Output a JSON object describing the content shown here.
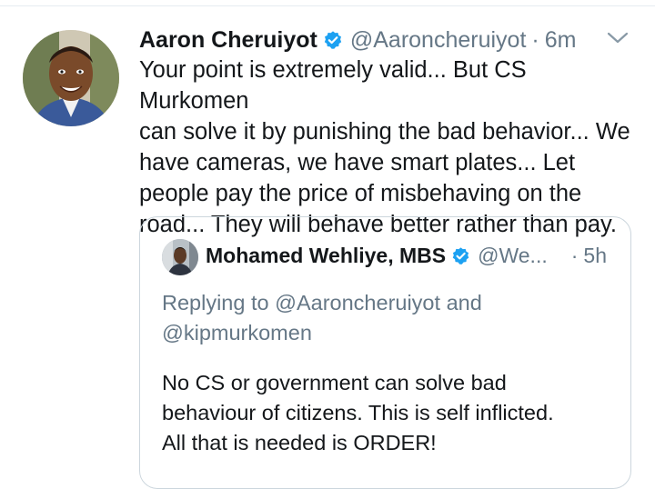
{
  "tweet": {
    "author": {
      "display_name": "Aaron Cheruiyot",
      "handle": "@Aaroncheruiyot",
      "verified_icon": "verified-badge-icon",
      "avatar": "avatar"
    },
    "separator": "·",
    "time": "6m",
    "menu_icon": "chevron-down-icon",
    "text": "Your point is extremely valid... But CS Murkomen\ncan solve it by punishing the bad behavior... We\nhave cameras, we have smart plates... Let\npeople pay the price of misbehaving on the\nroad... They will behave better rather than pay."
  },
  "quoted_tweet": {
    "author": {
      "display_name": "Mohamed Wehliye, MBS",
      "handle": "@We...",
      "verified_icon": "verified-badge-icon"
    },
    "separator": "·",
    "time": "5h",
    "replying_to_prefix": "Replying to",
    "replying_to_1": "@Aaroncheruiyot",
    "replying_to_and": "and",
    "replying_to_2": "@kipmurkomen",
    "text": "No CS or government can solve bad\nbehaviour of citizens. This is self inflicted.\nAll that is needed is ORDER!"
  },
  "colors": {
    "primary_text": "#14171a",
    "secondary_text": "#657786",
    "verified_blue": "#1da1f2",
    "border": "#ccd6dd"
  }
}
